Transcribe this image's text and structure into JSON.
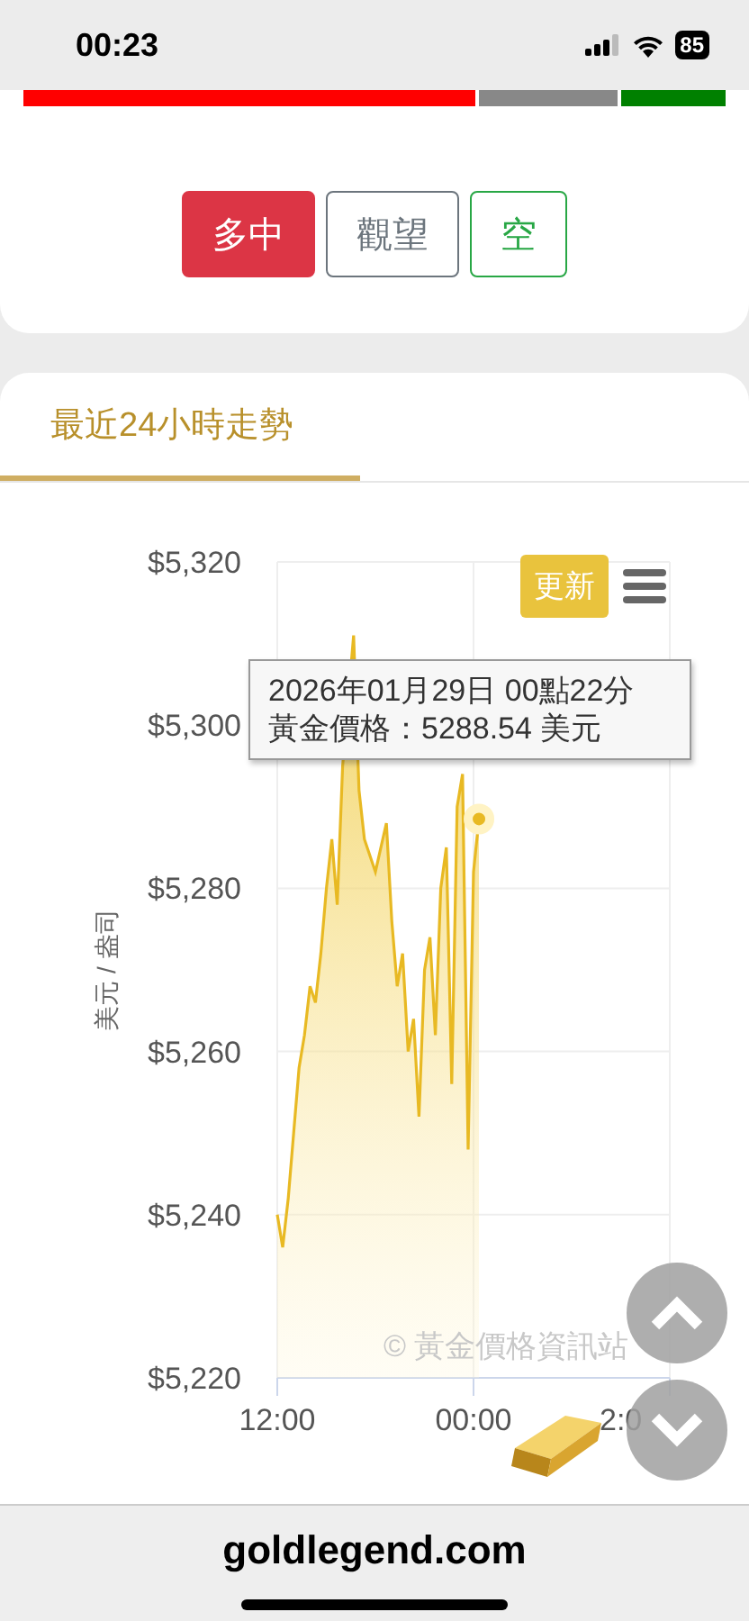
{
  "status_bar": {
    "time": "00:23",
    "battery": "85"
  },
  "sentiment_bar": [
    {
      "kind": "long",
      "color": "#ff0000"
    },
    {
      "kind": "wait",
      "color": "#888888"
    },
    {
      "kind": "short",
      "color": "#008000"
    }
  ],
  "buttons": [
    {
      "label": "多中",
      "selected": true,
      "color": "#dc3545"
    },
    {
      "label": "觀望",
      "selected": false,
      "color": "#6c757d"
    },
    {
      "label": "空",
      "selected": false,
      "color": "#28a745"
    }
  ],
  "tabs": [
    {
      "label": "最近24小時走勢",
      "selected": true
    }
  ],
  "chart": {
    "update_button": "更新",
    "tooltip": [
      "2026年01月29日 00點22分",
      "黃金價格：5288.54 美元"
    ],
    "credit": "© 黃金價格資訊站",
    "chart_data": {
      "type": "area",
      "grid": true,
      "ylabel": "美元 / 盎司",
      "ylim": [
        5220,
        5320
      ],
      "yticks": [
        {
          "value": 5220,
          "label": "$5,220"
        },
        {
          "value": 5240,
          "label": "$5,240"
        },
        {
          "value": 5260,
          "label": "$5,260"
        },
        {
          "value": 5280,
          "label": "$5,280"
        },
        {
          "value": 5300,
          "label": "$5,300"
        },
        {
          "value": 5320,
          "label": "$5,320"
        }
      ],
      "categories": [
        "12:00",
        null,
        null,
        null,
        null,
        null,
        null,
        null,
        null,
        null,
        null,
        null,
        null,
        null,
        null,
        null,
        null,
        null,
        null,
        null,
        null,
        null,
        null,
        null,
        null,
        null,
        null,
        null,
        null,
        null,
        null,
        null,
        null,
        null,
        null,
        null,
        "00:00",
        null,
        null,
        null,
        null,
        null,
        null,
        null,
        null,
        null,
        null,
        null,
        null,
        null,
        null,
        null,
        null,
        null,
        null,
        null,
        null,
        null,
        null,
        null,
        null,
        null,
        null,
        null,
        null,
        null,
        null,
        null,
        null,
        null,
        null,
        null,
        "2:0"
      ],
      "series": [
        {
          "color": "#e8b923",
          "values": [
            5240,
            5236,
            5242,
            5250,
            5258,
            5262,
            5268,
            5266,
            5272,
            5280,
            5286,
            5278,
            5295,
            null,
            5311,
            5292,
            5286,
            null,
            5282,
            null,
            5288,
            5276,
            5268,
            5272,
            5260,
            5264,
            5252,
            5270,
            5274,
            5262,
            5280,
            5285,
            5256,
            5290,
            5294,
            5248,
            5282,
            5288.5,
            null,
            null,
            null,
            null,
            null,
            null,
            null,
            null,
            null,
            null,
            null,
            null,
            null,
            null,
            null,
            null,
            null,
            null,
            null,
            null,
            null,
            null,
            null,
            null,
            null,
            null,
            null,
            null,
            null,
            null,
            null,
            null,
            null,
            null,
            null
          ]
        }
      ]
    }
  },
  "address_bar": {
    "url": "goldlegend.com"
  }
}
